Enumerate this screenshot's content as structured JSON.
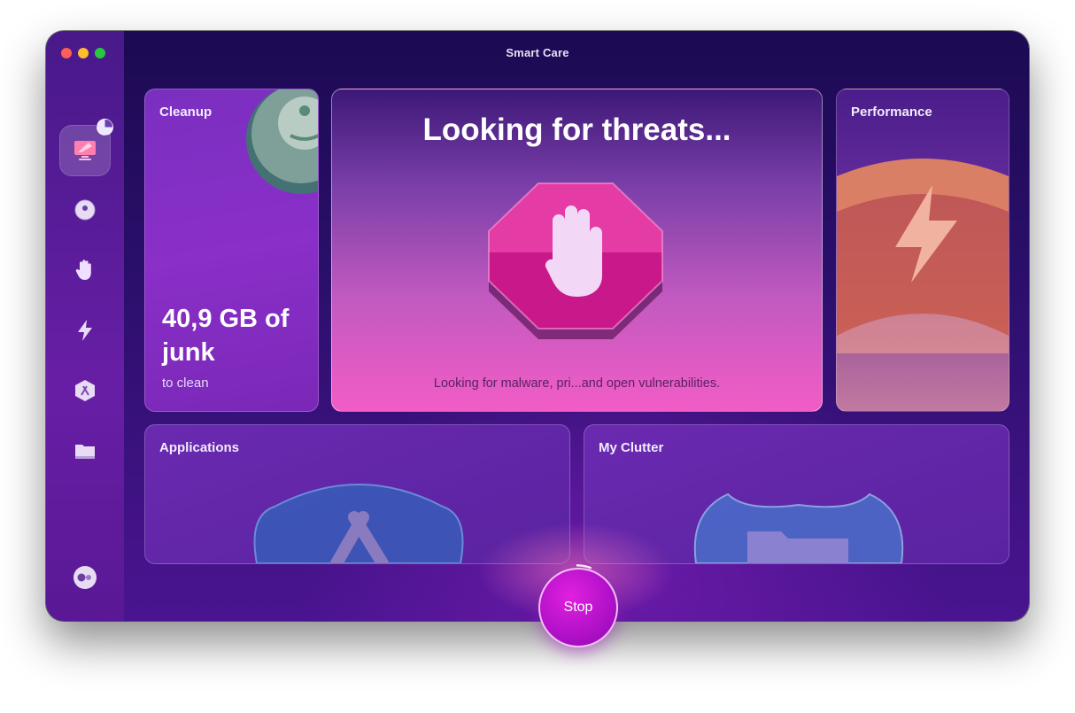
{
  "window": {
    "title": "Smart Care"
  },
  "sidebar": {
    "items": [
      {
        "name": "smart-care",
        "icon": "monitor-sweep-icon",
        "active": true
      },
      {
        "name": "cleanup",
        "icon": "disc-icon"
      },
      {
        "name": "protection",
        "icon": "hand-icon"
      },
      {
        "name": "performance",
        "icon": "lightning-icon"
      },
      {
        "name": "applications",
        "icon": "apps-icon"
      },
      {
        "name": "my-clutter",
        "icon": "folder-icon"
      }
    ],
    "footer_icon": "assistant-toggle-icon"
  },
  "cards": {
    "cleanup": {
      "title": "Cleanup",
      "value": "40,9 GB of junk",
      "subtitle": "to clean"
    },
    "threats": {
      "title": "Looking for threats...",
      "description": "Looking for malware, pri...and open vulnerabilities.",
      "icon": "stop-hand-icon"
    },
    "performance": {
      "title": "Performance",
      "icon": "lightning-icon"
    },
    "applications": {
      "title": "Applications",
      "icon": "apps-icon"
    },
    "clutter": {
      "title": "My Clutter",
      "icon": "folder-icon"
    }
  },
  "actions": {
    "stop_label": "Stop"
  },
  "colors": {
    "window_bg": "#2a0f6a",
    "sidebar_bg": "#5a1895",
    "threat_pink": "#f25cc6",
    "stop_button": "#c010d0"
  }
}
